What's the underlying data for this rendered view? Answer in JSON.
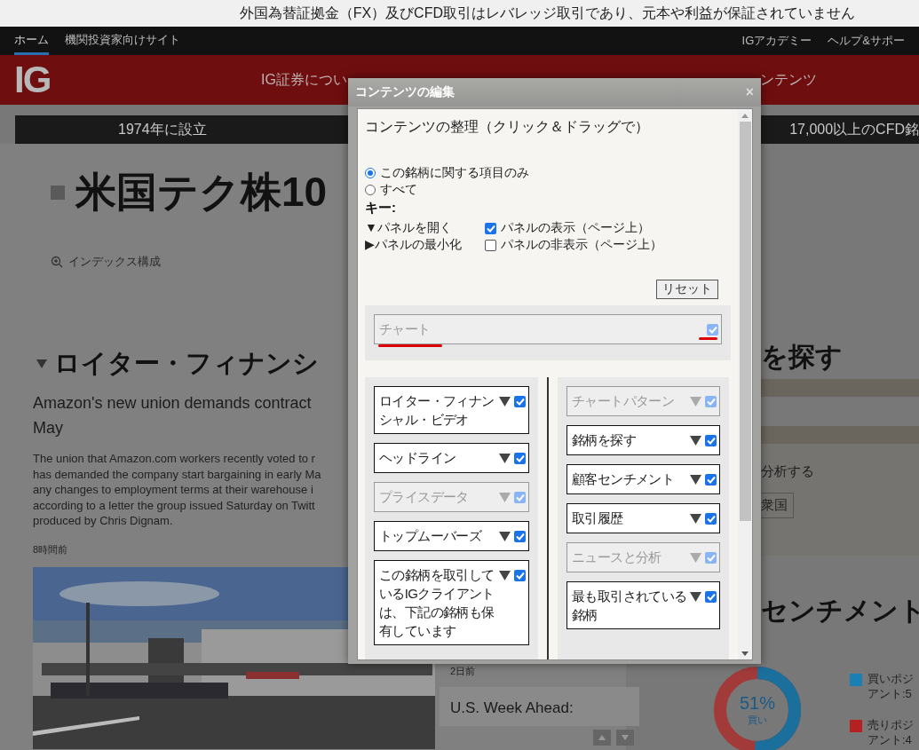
{
  "top_notice": "外国為替証拠金（FX）及びCFD取引はレバレッジ取引であり、元本や利益が保証されていません",
  "top_nav": {
    "left": [
      {
        "label": "ホーム",
        "selected": true
      },
      {
        "label": "機関投資家向けサイト",
        "selected": false
      }
    ],
    "right": [
      "IGアカデミー",
      "ヘルプ&サポー"
    ]
  },
  "main_nav": {
    "logo": "IG",
    "items": [
      "IG証券につい",
      "ンテンツ"
    ]
  },
  "info_bar": [
    "1974年に設立",
    "17,000以上のCFD銘"
  ],
  "left_column": {
    "title": "米国テク株10",
    "index_link": "インデックス構成",
    "section_title": "ロイター・フィナンシ",
    "headline_lines": [
      "Amazon's new union demands contract",
      "May"
    ],
    "summary_lines": [
      "The union that Amazon.com workers recently voted to r",
      "has demanded the company start bargaining in early Ma",
      "any changes to employment terms at their warehouse i",
      "according to a letter the group issued Saturday on Twitt",
      "produced by Chris Dignam."
    ],
    "age": "8時間前",
    "photo": {
      "kind": "picture"
    }
  },
  "center_column": {
    "age": "2日前",
    "headline": "U.S. Week Ahead:"
  },
  "right_column": {
    "section_title": "を探す",
    "analysis_text": "分析する",
    "chip": "衆国",
    "sentiment_title": "センチメント",
    "sentiment": {
      "level": 0.51,
      "percent": "51%",
      "label": "買い",
      "legend": [
        {
          "lines": [
            "買いポジ",
            "アント:5"
          ],
          "color": "#1a7fb5"
        },
        {
          "lines": [
            "売りポジ",
            "アント:4"
          ],
          "color": "#b52020"
        }
      ]
    }
  },
  "dialog": {
    "title": "コンテンツの編集",
    "close": "×",
    "heading": "コンテンツの整理（クリック＆ドラッグで）",
    "scope_options": [
      {
        "label": "この銘柄に関する項目のみ",
        "selected": true
      },
      {
        "label": "すべて",
        "selected": false
      }
    ],
    "key_title": "キー:",
    "key_actions": [
      "▼パネルを開く",
      "▶パネルの最小化"
    ],
    "key_states": [
      {
        "label": "パネルの表示（ページ上）",
        "checked": true
      },
      {
        "label": "パネルの非表示（ページ上）",
        "checked": false
      }
    ],
    "reset": "リセット",
    "top_panel": {
      "label": "チャート",
      "disabled": true,
      "checked": true
    },
    "left_panels": [
      {
        "label": "ロイター・フィナンシャル・ビデオ",
        "disabled": false,
        "checked": true
      },
      {
        "label": "ヘッドライン",
        "disabled": false,
        "checked": true
      },
      {
        "label": "プライスデータ",
        "disabled": true,
        "checked": true
      },
      {
        "label": "トップムーバーズ",
        "disabled": false,
        "checked": true
      },
      {
        "label": "この銘柄を取引しているIGクライアントは、下記の銘柄も保有しています",
        "disabled": false,
        "checked": true
      }
    ],
    "right_panels": [
      {
        "label": "チャートパターン",
        "disabled": true,
        "checked": true
      },
      {
        "label": "銘柄を探す",
        "disabled": false,
        "checked": true
      },
      {
        "label": "顧客センチメント",
        "disabled": false,
        "checked": true
      },
      {
        "label": "取引履歴",
        "disabled": false,
        "checked": true
      },
      {
        "label": "ニュースと分析",
        "disabled": true,
        "checked": true
      },
      {
        "label": "最も取引されている銘柄",
        "disabled": false,
        "checked": true
      }
    ]
  }
}
